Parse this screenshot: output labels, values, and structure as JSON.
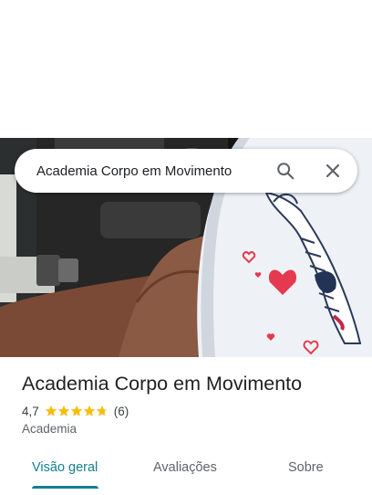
{
  "search": {
    "query": "Academia Corpo em Movimento"
  },
  "place": {
    "name": "Academia Corpo em Movimento",
    "rating": "4,7",
    "rating_fraction": 0.94,
    "review_count": "(6)",
    "category": "Academia"
  },
  "tabs": [
    {
      "label": "Visão geral",
      "active": true
    },
    {
      "label": "Avaliações",
      "active": false
    },
    {
      "label": "Sobre",
      "active": false
    }
  ],
  "colors": {
    "accent": "#137f8f",
    "star": "#fbbc04",
    "heart": "#e53950"
  },
  "icons": {
    "search": "search-icon",
    "close": "close-icon",
    "star": "star-icon"
  }
}
